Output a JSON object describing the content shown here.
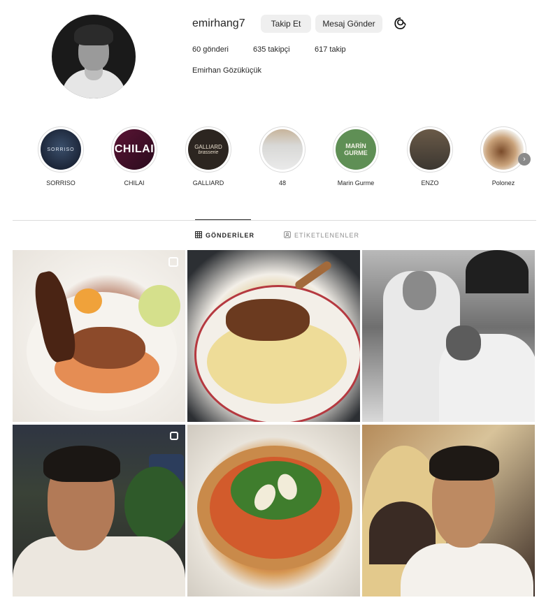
{
  "profile": {
    "username": "emirhang7",
    "follow_label": "Takip Et",
    "message_label": "Mesaj Gönder",
    "posts": "60 gönderi",
    "followers": "635 takipçi",
    "following": "617 takip",
    "full_name": "Emirhan Gözüküçük"
  },
  "highlights": [
    {
      "label": "SORRISO",
      "cover_text": "SORRISO"
    },
    {
      "label": "CHILAI",
      "cover_text": "CHILAI"
    },
    {
      "label": "GALLIARD",
      "cover_text": "GALLIARD",
      "cover_subtext": "brasserie"
    },
    {
      "label": "48"
    },
    {
      "label": "Marin Gurme",
      "cover_text": "MARİN GURME"
    },
    {
      "label": "ENZO"
    },
    {
      "label": "Polonez"
    }
  ],
  "tabs": {
    "posts": "GÖNDERİLER",
    "tagged": "ETİKETLENENLER"
  },
  "icons": {
    "threads": "threads-icon",
    "grid": "grid-icon",
    "tagged": "tagged-icon",
    "next": "chevron-right-icon",
    "multi": "multiple-photos-icon"
  }
}
